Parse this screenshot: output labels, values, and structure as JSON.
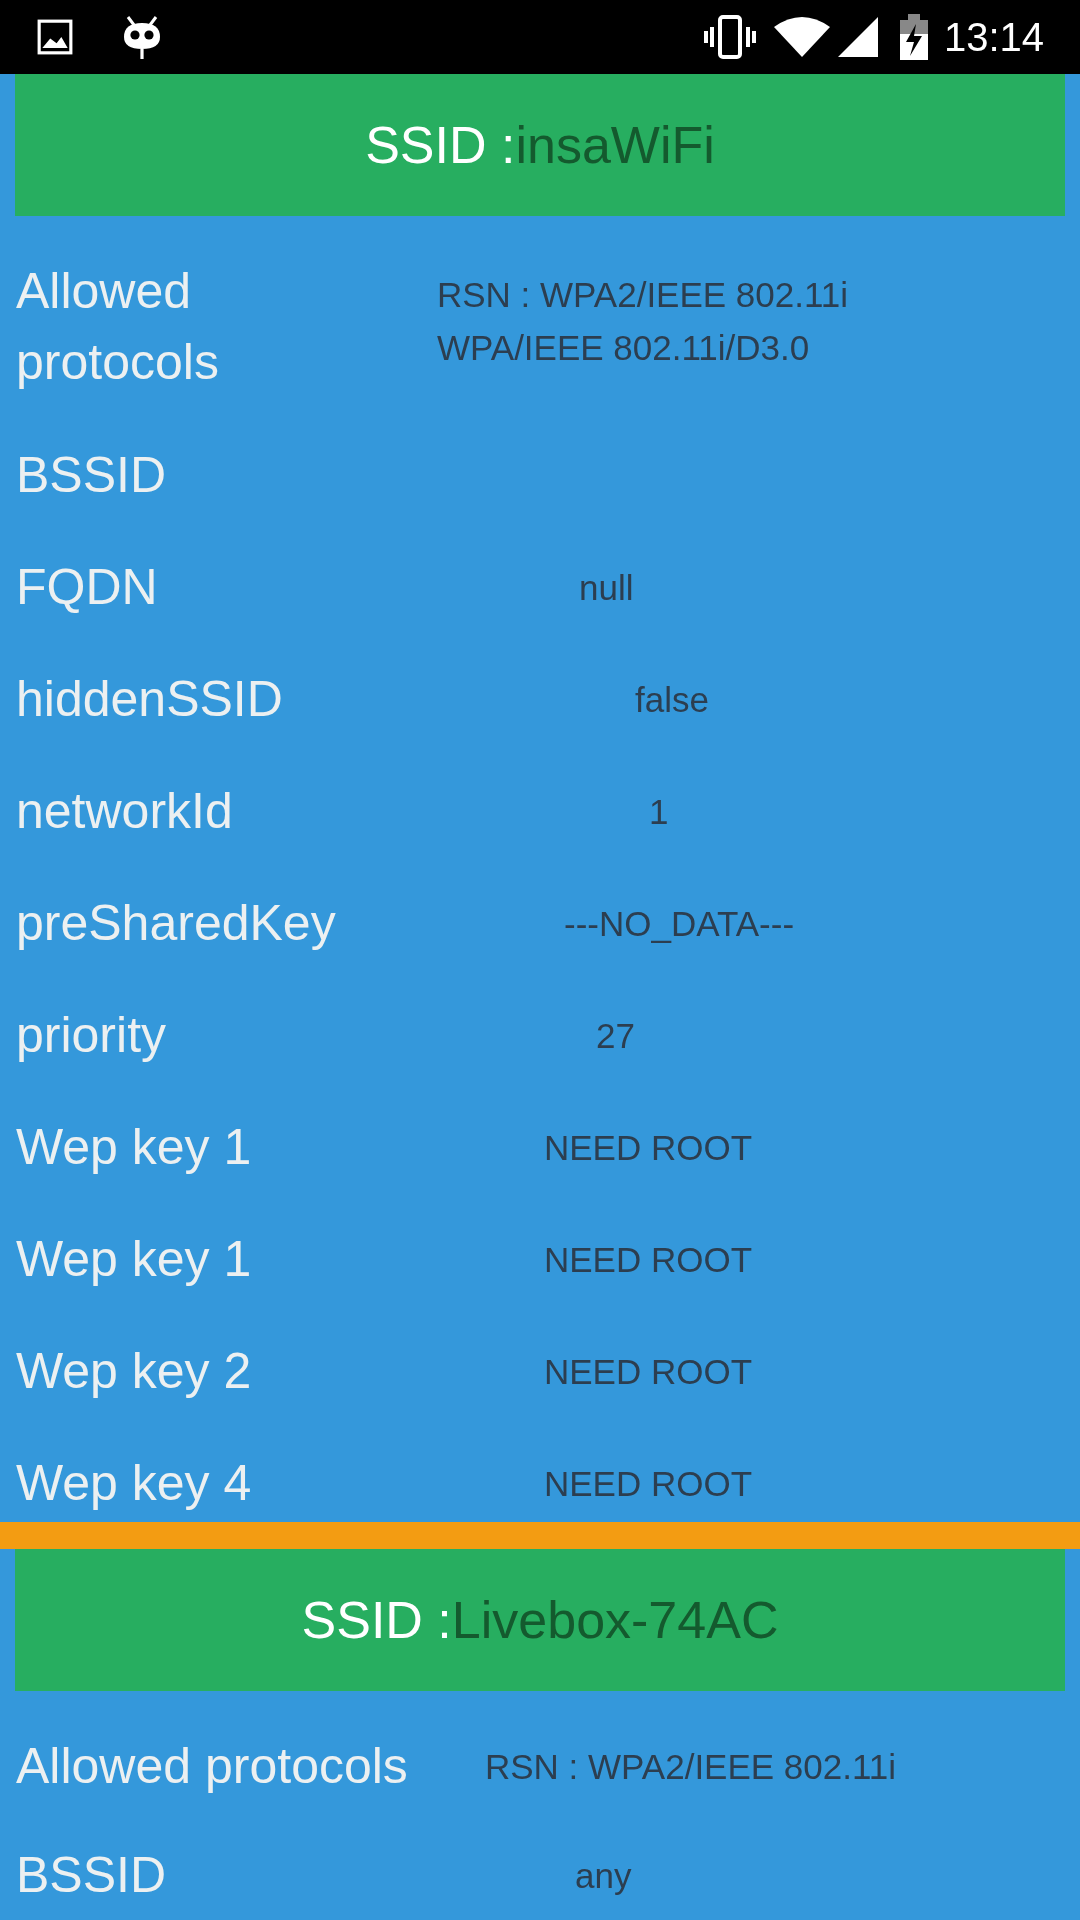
{
  "status_bar": {
    "time": "13:14"
  },
  "sections": [
    {
      "ssid_prefix": "SSID :",
      "ssid": "insaWiFi",
      "rows": [
        {
          "label_lines": [
            "Allowed",
            "protocols"
          ],
          "value_lines": [
            "RSN : WPA2/IEEE 802.11i",
            "WPA/IEEE 802.11i/D3.0"
          ]
        },
        {
          "label_lines": [
            "BSSID"
          ]
        },
        {
          "label_lines": [
            "FQDN"
          ],
          "value_lines": [
            "null"
          ]
        },
        {
          "label_lines": [
            "hiddenSSID"
          ],
          "value_lines": [
            "false"
          ]
        },
        {
          "label_lines": [
            "networkId"
          ],
          "value_lines": [
            "1"
          ]
        },
        {
          "label_lines": [
            "preSharedKey"
          ],
          "value_lines": [
            "---NO_DATA---"
          ]
        },
        {
          "label_lines": [
            "priority"
          ],
          "value_lines": [
            "27"
          ]
        },
        {
          "label_lines": [
            "Wep key 1"
          ],
          "value_lines": [
            "NEED ROOT"
          ]
        },
        {
          "label_lines": [
            "Wep key 1"
          ],
          "value_lines": [
            "NEED ROOT"
          ]
        },
        {
          "label_lines": [
            "Wep key 2"
          ],
          "value_lines": [
            "NEED ROOT"
          ]
        },
        {
          "label_lines": [
            "Wep key 4"
          ],
          "value_lines": [
            "NEED ROOT"
          ]
        }
      ]
    },
    {
      "ssid_prefix": "SSID :",
      "ssid": "Livebox-74AC",
      "rows": [
        {
          "label_lines": [
            "Allowed protocols"
          ],
          "value_lines": [
            "RSN : WPA2/IEEE 802.11i"
          ]
        },
        {
          "label_lines": [
            "BSSID"
          ],
          "value_lines": [
            "any"
          ]
        }
      ]
    }
  ]
}
